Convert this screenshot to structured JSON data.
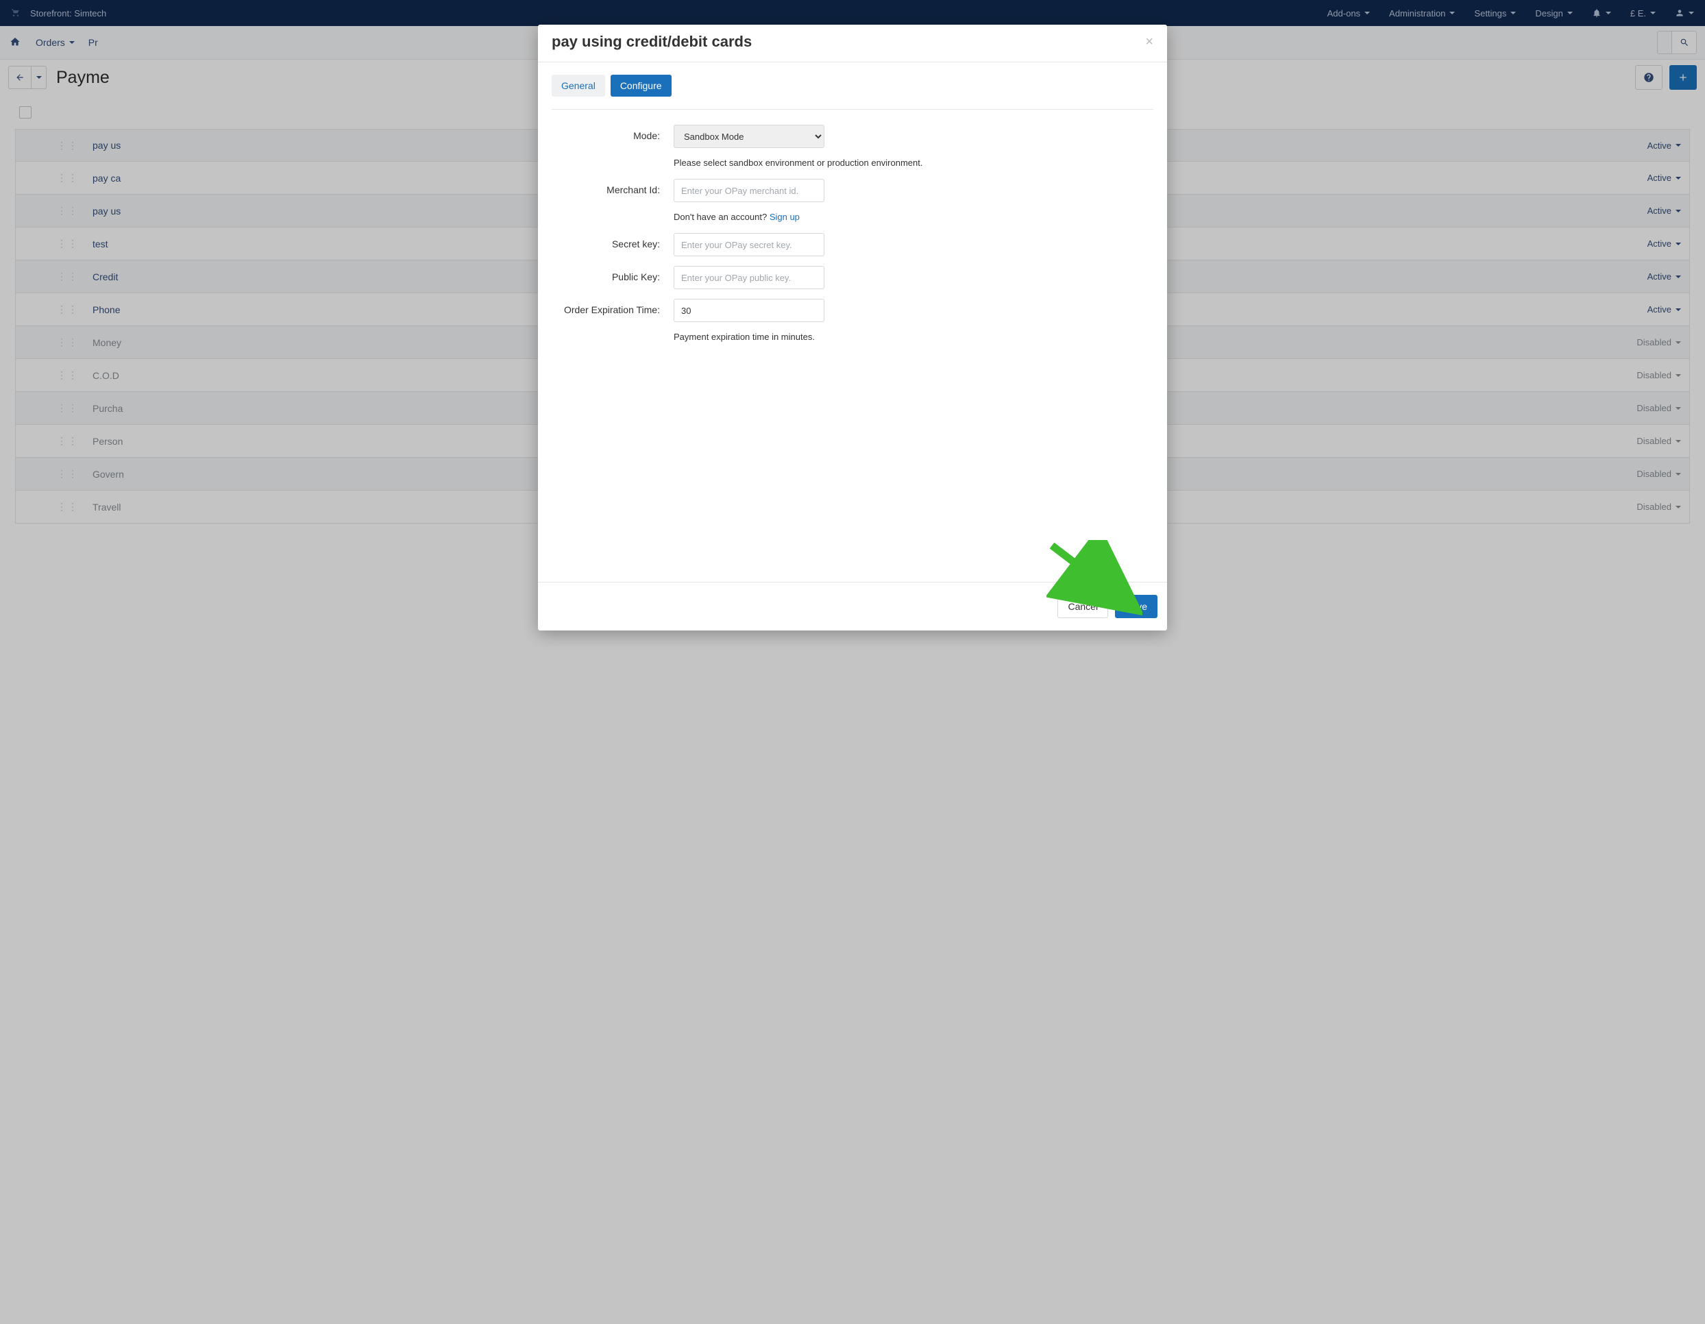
{
  "topnav": {
    "storefront_label": "Storefront: Simtech",
    "addons": "Add-ons",
    "administration": "Administration",
    "settings": "Settings",
    "design": "Design",
    "currency_user": "£ E."
  },
  "subnav": {
    "orders": "Orders",
    "products_prefix": "Pr"
  },
  "page_title": "Payme",
  "rows": [
    {
      "name": "pay us",
      "status": "Active",
      "enabled": true,
      "alt": true
    },
    {
      "name": "pay ca",
      "status": "Active",
      "enabled": true,
      "alt": false
    },
    {
      "name": "pay us",
      "status": "Active",
      "enabled": true,
      "alt": true
    },
    {
      "name": "test",
      "status": "Active",
      "enabled": true,
      "alt": false
    },
    {
      "name": "Credit",
      "status": "Active",
      "enabled": true,
      "alt": true
    },
    {
      "name": "Phone",
      "status": "Active",
      "enabled": true,
      "alt": false
    },
    {
      "name": "Money",
      "status": "Disabled",
      "enabled": false,
      "alt": true
    },
    {
      "name": "C.O.D",
      "status": "Disabled",
      "enabled": false,
      "alt": false
    },
    {
      "name": "Purcha",
      "status": "Disabled",
      "enabled": false,
      "alt": true
    },
    {
      "name": "Person",
      "status": "Disabled",
      "enabled": false,
      "alt": false
    },
    {
      "name": "Govern",
      "status": "Disabled",
      "enabled": false,
      "alt": true
    },
    {
      "name": "Travell",
      "status": "Disabled",
      "enabled": false,
      "alt": false
    }
  ],
  "modal": {
    "title": "pay using credit/debit cards",
    "tab_general": "General",
    "tab_configure": "Configure",
    "mode_label": "Mode:",
    "mode_value": "Sandbox Mode",
    "mode_help": "Please select sandbox environment or production environment.",
    "merchant_label": "Merchant Id:",
    "merchant_placeholder": "Enter your OPay merchant id.",
    "merchant_help_prefix": "Don't have an account? ",
    "merchant_signup": "Sign up",
    "secret_label": "Secret key:",
    "secret_placeholder": "Enter your OPay secret key.",
    "public_label": "Public Key:",
    "public_placeholder": "Enter your OPay public key.",
    "expiration_label": "Order Expiration Time:",
    "expiration_value": "30",
    "expiration_help": "Payment expiration time in minutes.",
    "cancel": "Cancel",
    "save": "Save"
  }
}
